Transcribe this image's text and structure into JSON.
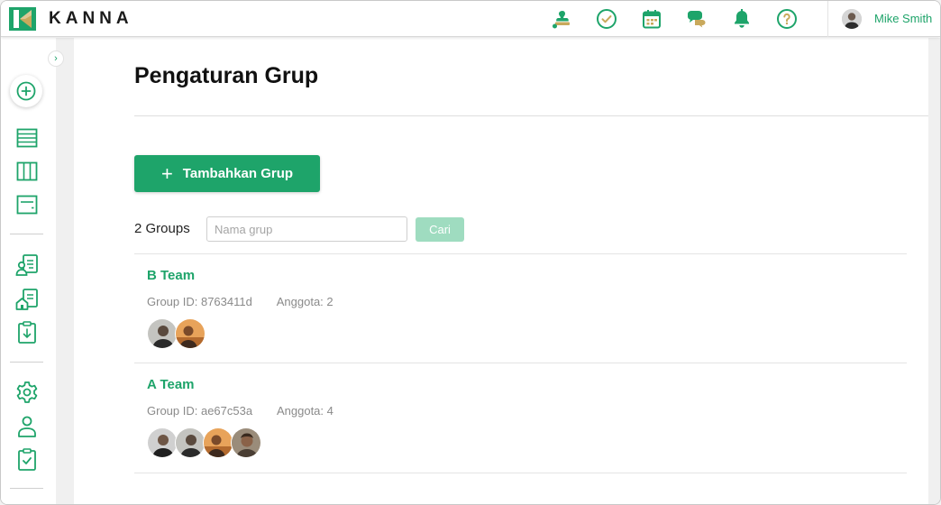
{
  "app": {
    "brand": "KANNA",
    "accent": "#1ea46a"
  },
  "header": {
    "icons": [
      "stamp-icon",
      "check-circle-icon",
      "calendar-icon",
      "chat-icon",
      "bell-icon",
      "help-icon"
    ],
    "user_name": "Mike Smith"
  },
  "sidebar": {
    "items": [
      "add-circle-icon",
      "list-view-icon",
      "board-view-icon",
      "card-view-icon",
      "client-doc-icon",
      "building-doc-icon",
      "download-clipboard-icon",
      "settings-gear-icon",
      "person-icon",
      "checklist-clipboard-icon"
    ]
  },
  "page": {
    "title": "Pengaturan Grup",
    "add_button_label": "Tambahkan Grup",
    "group_count": "2 Groups",
    "search_placeholder": "Nama grup",
    "search_button_label": "Cari"
  },
  "groups": [
    {
      "name": "B Team",
      "group_id": "Group ID: 8763411d",
      "members": "Anggota: 2"
    },
    {
      "name": "A Team",
      "group_id": "Group ID: ae67c53a",
      "members": "Anggota: 4"
    }
  ]
}
